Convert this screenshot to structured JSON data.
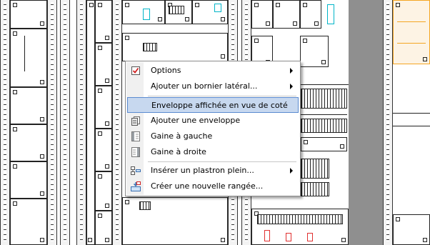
{
  "context_menu": {
    "items": [
      {
        "label": "Options",
        "icon": "checkbox-icon",
        "submenu": true
      },
      {
        "label": "Ajouter un bornier latéral...",
        "icon": null,
        "submenu": true
      },
      {
        "label": "Enveloppe affichée en vue de coté",
        "icon": null,
        "submenu": false,
        "highlighted": true
      },
      {
        "label": "Ajouter une enveloppe",
        "icon": "add-enclosure-icon",
        "submenu": false
      },
      {
        "label": "Gaine à gauche",
        "icon": "duct-left-icon",
        "submenu": false
      },
      {
        "label": "Gaine à droite",
        "icon": "duct-right-icon",
        "submenu": false
      },
      {
        "label": "Insérer un plastron plein...",
        "icon": "insert-plate-icon",
        "submenu": true
      },
      {
        "label": "Créer une nouvelle rangée...",
        "icon": "new-row-icon",
        "submenu": false
      }
    ]
  },
  "colors": {
    "highlight_bg": "#c7d8ef",
    "highlight_border": "#5b8bd0",
    "menu_border": "#8c8c8c",
    "drawing_accent_cyan": "#00b5c8",
    "drawing_accent_red": "#e03030",
    "panel_orange": "#f5a623"
  }
}
